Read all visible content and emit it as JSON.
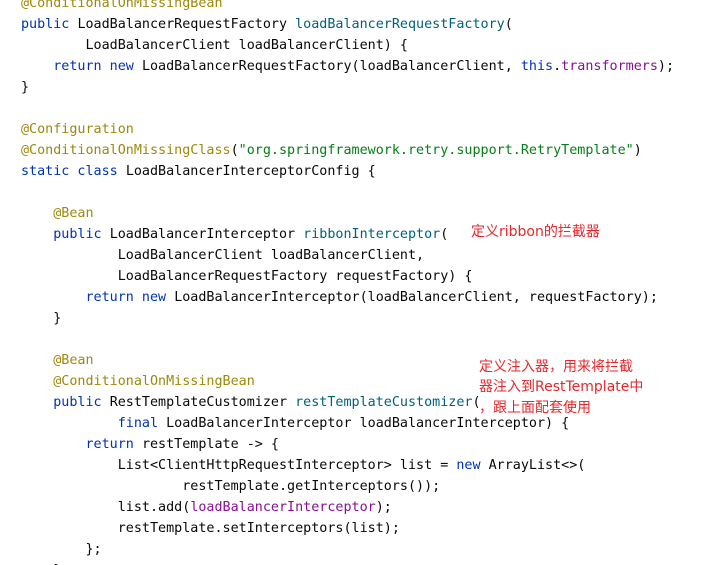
{
  "colors": {
    "keyword": "#0033b3",
    "annotation": "#9e880d",
    "string": "#067d17",
    "function": "#00627a",
    "field": "#871094",
    "text": "#080808",
    "note": "#e8262b",
    "background": "#ffffff"
  },
  "code": [
    [
      {
        "t": "@ConditionalOnMissingBean",
        "k": "ann"
      }
    ],
    [
      {
        "t": "public ",
        "k": "kw"
      },
      {
        "t": "LoadBalancerRequestFactory ",
        "k": "txt"
      },
      {
        "t": "loadBalancerRequestFactory",
        "k": "fn"
      },
      {
        "t": "(",
        "k": "txt"
      }
    ],
    [
      {
        "t": "        LoadBalancerClient loadBalancerClient) {",
        "k": "txt"
      }
    ],
    [
      {
        "t": "    ",
        "k": "txt"
      },
      {
        "t": "return new ",
        "k": "kw"
      },
      {
        "t": "LoadBalancerRequestFactory(loadBalancerClient, ",
        "k": "txt"
      },
      {
        "t": "this",
        "k": "kw"
      },
      {
        "t": ".",
        "k": "txt"
      },
      {
        "t": "transformers",
        "k": "fld"
      },
      {
        "t": ");",
        "k": "txt"
      }
    ],
    [
      {
        "t": "}",
        "k": "txt"
      }
    ],
    [],
    [
      {
        "t": "@Configuration",
        "k": "ann"
      }
    ],
    [
      {
        "t": "@ConditionalOnMissingClass",
        "k": "ann"
      },
      {
        "t": "(",
        "k": "txt"
      },
      {
        "t": "\"org.springframework.retry.support.RetryTemplate\"",
        "k": "str"
      },
      {
        "t": ")",
        "k": "txt"
      }
    ],
    [
      {
        "t": "static class ",
        "k": "kw"
      },
      {
        "t": "LoadBalancerInterceptorConfig {",
        "k": "txt"
      }
    ],
    [],
    [
      {
        "t": "    ",
        "k": "txt"
      },
      {
        "t": "@Bean",
        "k": "ann"
      }
    ],
    [
      {
        "t": "    ",
        "k": "txt"
      },
      {
        "t": "public ",
        "k": "kw"
      },
      {
        "t": "LoadBalancerInterceptor ",
        "k": "txt"
      },
      {
        "t": "ribbonInterceptor",
        "k": "fn"
      },
      {
        "t": "(",
        "k": "txt"
      }
    ],
    [
      {
        "t": "            LoadBalancerClient loadBalancerClient,",
        "k": "txt"
      }
    ],
    [
      {
        "t": "            LoadBalancerRequestFactory requestFactory) {",
        "k": "txt"
      }
    ],
    [
      {
        "t": "        ",
        "k": "txt"
      },
      {
        "t": "return new ",
        "k": "kw"
      },
      {
        "t": "LoadBalancerInterceptor(loadBalancerClient, requestFactory);",
        "k": "txt"
      }
    ],
    [
      {
        "t": "    }",
        "k": "txt"
      }
    ],
    [],
    [
      {
        "t": "    ",
        "k": "txt"
      },
      {
        "t": "@Bean",
        "k": "ann"
      }
    ],
    [
      {
        "t": "    ",
        "k": "txt"
      },
      {
        "t": "@ConditionalOnMissingBean",
        "k": "ann"
      }
    ],
    [
      {
        "t": "    ",
        "k": "txt"
      },
      {
        "t": "public ",
        "k": "kw"
      },
      {
        "t": "RestTemplateCustomizer ",
        "k": "txt"
      },
      {
        "t": "restTemplateCustomizer",
        "k": "fn"
      },
      {
        "t": "(",
        "k": "txt"
      }
    ],
    [
      {
        "t": "            ",
        "k": "txt"
      },
      {
        "t": "final ",
        "k": "kw"
      },
      {
        "t": "LoadBalancerInterceptor loadBalancerInterceptor) {",
        "k": "txt"
      }
    ],
    [
      {
        "t": "        ",
        "k": "txt"
      },
      {
        "t": "return ",
        "k": "kw"
      },
      {
        "t": "restTemplate -> {",
        "k": "txt"
      }
    ],
    [
      {
        "t": "            List<ClientHttpRequestInterceptor> list = ",
        "k": "txt"
      },
      {
        "t": "new ",
        "k": "kw"
      },
      {
        "t": "ArrayList<>(",
        "k": "txt"
      }
    ],
    [
      {
        "t": "                    restTemplate.getInterceptors());",
        "k": "txt"
      }
    ],
    [
      {
        "t": "            list.add(",
        "k": "txt"
      },
      {
        "t": "loadBalancerInterceptor",
        "k": "fld"
      },
      {
        "t": ");",
        "k": "txt"
      }
    ],
    [
      {
        "t": "            restTemplate.setInterceptors(list);",
        "k": "txt"
      }
    ],
    [
      {
        "t": "        };",
        "k": "txt"
      }
    ],
    [
      {
        "t": "    }",
        "k": "txt"
      }
    ]
  ],
  "annotations": {
    "ribbon_note": "定义ribbon的拦截器",
    "customizer_note": [
      "定义注入器，用来将拦截",
      "器注入到RestTemplate中",
      "，跟上面配套使用"
    ]
  }
}
